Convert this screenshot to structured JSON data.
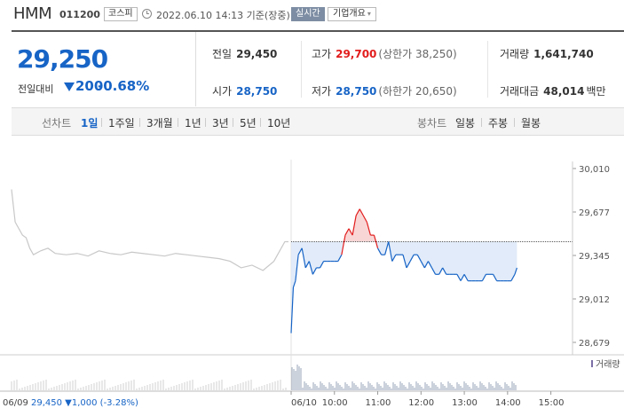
{
  "header": {
    "name": "HMM",
    "code": "011200",
    "market": "코스피",
    "datetime": "2022.06.10 14:13 기준(장중)",
    "realtime": "실시간",
    "company_info": "기업개요",
    "company_info_caret": "▾"
  },
  "price": {
    "current": "29,250",
    "change_label": "전일대비",
    "change_amount": "200",
    "change_rate": "-0.68%",
    "direction": "down"
  },
  "stats": {
    "prev_close": {
      "label": "전일",
      "value": "29,450"
    },
    "high": {
      "label": "고가",
      "value": "29,700",
      "sub": "(상한가 38,250)"
    },
    "volume": {
      "label": "거래량",
      "value": "1,641,740"
    },
    "open": {
      "label": "시가",
      "value": "28,750"
    },
    "low": {
      "label": "저가",
      "value": "28,750",
      "sub": "(하한가 20,650)"
    },
    "trade_value": {
      "label": "거래대금",
      "value": "48,014",
      "unit": "백만"
    }
  },
  "periods": {
    "line_label": "선차트",
    "line_items": [
      "1일",
      "1주일",
      "3개월",
      "1년",
      "3년",
      "5년",
      "10년"
    ],
    "active": "1일",
    "candle_label": "봉차트",
    "candle_items": [
      "일봉",
      "주봉",
      "월봉"
    ]
  },
  "colors": {
    "accent_blue": "#1764c6",
    "up_red": "#e21c1c",
    "area_blue": "#dce8f8",
    "area_red": "#f9d6d6",
    "prev_gray": "#c8c8c8"
  },
  "chart_data": {
    "type": "line",
    "ylim": [
      28679,
      30010
    ],
    "y_ticks": [
      "30,010",
      "29,677",
      "29,345",
      "29,012",
      "28,679"
    ],
    "x_ticks": [
      "06/10",
      "10:00",
      "11:00",
      "12:00",
      "13:00",
      "14:00",
      "15:00"
    ],
    "prev_close": 29450,
    "volume_label": "거래량",
    "prev_day": {
      "date": "06/09",
      "close": "29,450",
      "change": "▼1,000",
      "rate": "(-3.28%)",
      "x": [
        "09:00",
        "09:05",
        "09:10",
        "09:15",
        "09:20",
        "09:25",
        "09:30",
        "09:40",
        "09:50",
        "10:00",
        "10:15",
        "10:30",
        "10:45",
        "11:00",
        "11:15",
        "11:30",
        "11:45",
        "12:00",
        "12:15",
        "12:30",
        "12:45",
        "13:00",
        "13:15",
        "13:30",
        "13:45",
        "14:00",
        "14:15",
        "14:30",
        "14:45",
        "15:00",
        "15:15",
        "15:20"
      ],
      "values": [
        29850,
        29600,
        29550,
        29500,
        29480,
        29400,
        29350,
        29380,
        29400,
        29360,
        29350,
        29360,
        29340,
        29380,
        29360,
        29350,
        29370,
        29360,
        29350,
        29340,
        29360,
        29350,
        29340,
        29330,
        29320,
        29300,
        29250,
        29270,
        29230,
        29300,
        29450,
        29450
      ]
    },
    "series": [
      {
        "x": [
          "09:00",
          "09:03",
          "09:06",
          "09:10",
          "09:15",
          "09:20",
          "09:25",
          "09:30",
          "09:35",
          "09:40",
          "09:45",
          "09:50",
          "09:55",
          "10:00",
          "10:05",
          "10:10",
          "10:15",
          "10:20",
          "10:25",
          "10:30",
          "10:35",
          "10:40",
          "10:45",
          "10:50",
          "10:55",
          "11:00",
          "11:05",
          "11:10",
          "11:15",
          "11:20",
          "11:25",
          "11:30",
          "11:35",
          "11:40",
          "11:45",
          "11:50",
          "11:55",
          "12:00",
          "12:05",
          "12:10",
          "12:15",
          "12:20",
          "12:25",
          "12:30",
          "12:35",
          "12:40",
          "12:45",
          "12:50",
          "12:55",
          "13:00",
          "13:05",
          "13:10",
          "13:15",
          "13:20",
          "13:25",
          "13:30",
          "13:35",
          "13:40",
          "13:45",
          "13:50",
          "13:55",
          "14:00",
          "14:05",
          "14:10",
          "14:13"
        ],
        "values": [
          28750,
          29100,
          29150,
          29350,
          29400,
          29250,
          29300,
          29200,
          29250,
          29250,
          29300,
          29300,
          29300,
          29300,
          29300,
          29350,
          29500,
          29550,
          29500,
          29650,
          29700,
          29650,
          29600,
          29500,
          29500,
          29400,
          29350,
          29350,
          29450,
          29300,
          29350,
          29350,
          29350,
          29250,
          29300,
          29350,
          29350,
          29300,
          29250,
          29300,
          29250,
          29200,
          29200,
          29250,
          29200,
          29200,
          29200,
          29200,
          29150,
          29200,
          29150,
          29150,
          29150,
          29150,
          29150,
          29200,
          29200,
          29200,
          29150,
          29150,
          29150,
          29150,
          29150,
          29200,
          29250
        ]
      }
    ]
  }
}
